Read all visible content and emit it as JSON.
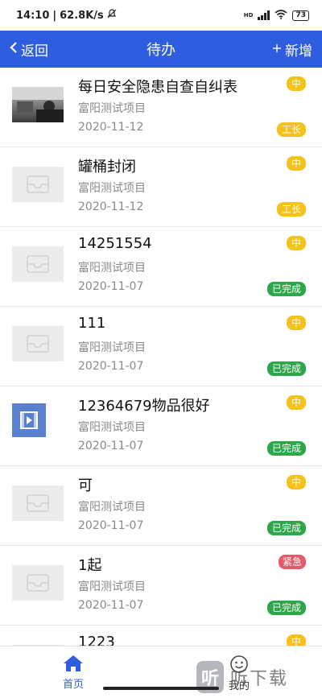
{
  "status_bar": {
    "time": "14:10",
    "speed": "62.8K/s",
    "network": "HD",
    "battery": "73"
  },
  "nav": {
    "back_label": "返回",
    "title": "待办",
    "add_label": "新增",
    "color": "#2f5de0"
  },
  "items": [
    {
      "title": "每日安全隐患自查自纠表",
      "project": "富阳测试项目",
      "date": "2020-11-12",
      "priority": "中",
      "status": "工长",
      "thumb": "photo"
    },
    {
      "title": "罐桶封闭",
      "project": "富阳测试项目",
      "date": "2020-11-12",
      "priority": "中",
      "status": "工长",
      "thumb": "placeholder"
    },
    {
      "title": "14251554",
      "project": "富阳测试项目",
      "date": "2020-11-07",
      "priority": "中",
      "status": "已完成",
      "thumb": "placeholder"
    },
    {
      "title": "111",
      "project": "富阳测试项目",
      "date": "2020-11-07",
      "priority": "中",
      "status": "已完成",
      "thumb": "placeholder"
    },
    {
      "title": "12364679物品很好",
      "project": "富阳测试项目",
      "date": "2020-11-07",
      "priority": "中",
      "status": "已完成",
      "thumb": "video"
    },
    {
      "title": "可",
      "project": "富阳测试项目",
      "date": "2020-11-07",
      "priority": "中",
      "status": "已完成",
      "thumb": "placeholder"
    },
    {
      "title": "1起",
      "project": "富阳测试项目",
      "date": "2020-11-07",
      "priority": "紧急",
      "status": "已完成",
      "thumb": "placeholder"
    },
    {
      "title": "1223",
      "project": "",
      "date": "",
      "priority": "中",
      "status": "",
      "thumb": "placeholder"
    }
  ],
  "tabs": {
    "home_label": "首页",
    "home_icon": "home-icon",
    "mine_label": "我的",
    "mine_icon": "smiley-icon"
  },
  "watermark": {
    "logo_char": "听",
    "text": "听下载"
  },
  "colors": {
    "priority_normal": "#f4c21b",
    "priority_urgent": "#e55a6a",
    "status_done": "#2ea64a",
    "status_foreman": "#f4c21b"
  }
}
